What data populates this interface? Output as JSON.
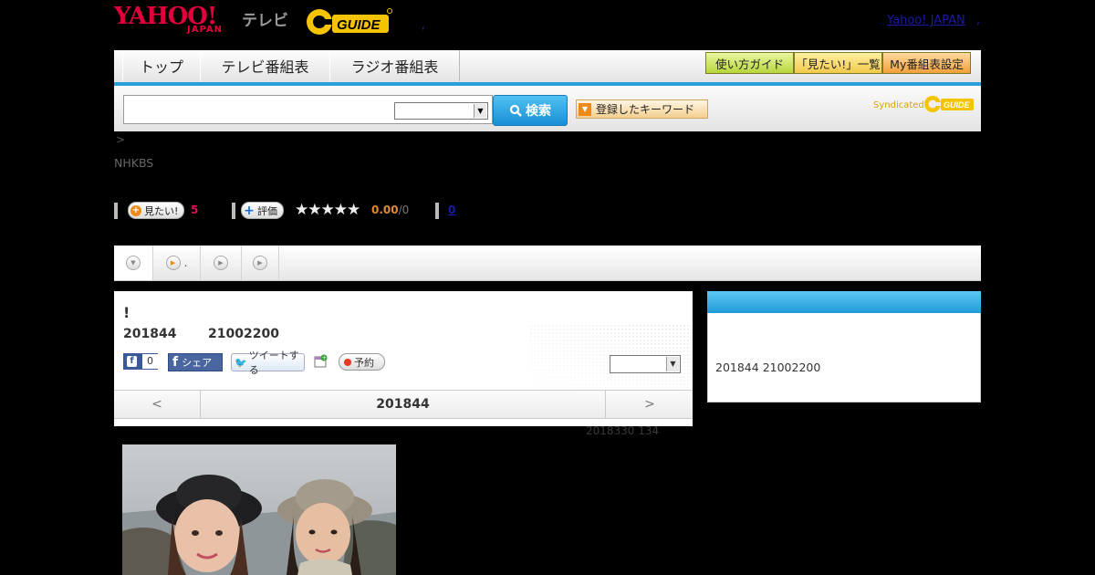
{
  "header": {
    "yahoo_logo": "YAHOO!",
    "yahoo_japan": "JAPAN",
    "tv_label": "テレビ",
    "gguide_logo": "G GUIDE",
    "comma": ",",
    "yahoo_japan_link": "Yahoo! JAPAN",
    "comma2": ","
  },
  "nav": {
    "tabs": [
      "トップ",
      "テレビ番組表",
      "ラジオ番組表"
    ],
    "guide_buttons": [
      "使い方ガイド",
      "「見たい!」一覧",
      "My番組表設定"
    ]
  },
  "search": {
    "input_value": "",
    "select_value": "",
    "button_label": "検索",
    "keyword_button": "登録したキーワード",
    "syndicated": "Syndicated"
  },
  "program": {
    "breadcrumb": ">",
    "channel": "NHKBS",
    "mitai_label": "見たい!",
    "mitai_count": "5",
    "rate_label": "評価",
    "rating_value": "0.00",
    "rating_count": "/0",
    "review_count": "0",
    "tab_dot": ".",
    "title": "!",
    "date": "201844",
    "time": "21002200",
    "fb_count": "0",
    "share_label": "シェア",
    "tweet_label": "ツイートする",
    "reserve_label": "予約",
    "date_nav": {
      "prev": "<",
      "current": "201844",
      "next": ">"
    },
    "updated": "2018330  134"
  },
  "side": {
    "text": "201844  21002200"
  },
  "colors": {
    "accent_blue": "#2b9fd9",
    "yahoo_red": "#e0003b",
    "gguide_yellow": "#f5c400",
    "mitai_pink": "#e0105a",
    "rating_orange": "#e08a30"
  }
}
